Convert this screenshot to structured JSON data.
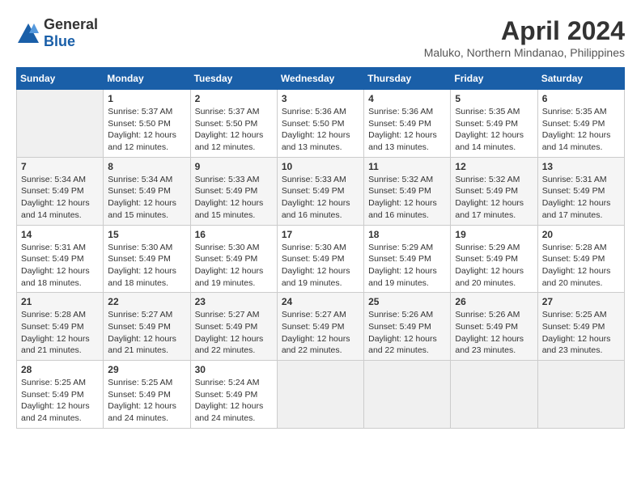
{
  "header": {
    "logo_general": "General",
    "logo_blue": "Blue",
    "month_year": "April 2024",
    "location": "Maluko, Northern Mindanao, Philippines"
  },
  "weekdays": [
    "Sunday",
    "Monday",
    "Tuesday",
    "Wednesday",
    "Thursday",
    "Friday",
    "Saturday"
  ],
  "weeks": [
    [
      {
        "day": "",
        "info": ""
      },
      {
        "day": "1",
        "info": "Sunrise: 5:37 AM\nSunset: 5:50 PM\nDaylight: 12 hours\nand 12 minutes."
      },
      {
        "day": "2",
        "info": "Sunrise: 5:37 AM\nSunset: 5:50 PM\nDaylight: 12 hours\nand 12 minutes."
      },
      {
        "day": "3",
        "info": "Sunrise: 5:36 AM\nSunset: 5:50 PM\nDaylight: 12 hours\nand 13 minutes."
      },
      {
        "day": "4",
        "info": "Sunrise: 5:36 AM\nSunset: 5:49 PM\nDaylight: 12 hours\nand 13 minutes."
      },
      {
        "day": "5",
        "info": "Sunrise: 5:35 AM\nSunset: 5:49 PM\nDaylight: 12 hours\nand 14 minutes."
      },
      {
        "day": "6",
        "info": "Sunrise: 5:35 AM\nSunset: 5:49 PM\nDaylight: 12 hours\nand 14 minutes."
      }
    ],
    [
      {
        "day": "7",
        "info": "Sunrise: 5:34 AM\nSunset: 5:49 PM\nDaylight: 12 hours\nand 14 minutes."
      },
      {
        "day": "8",
        "info": "Sunrise: 5:34 AM\nSunset: 5:49 PM\nDaylight: 12 hours\nand 15 minutes."
      },
      {
        "day": "9",
        "info": "Sunrise: 5:33 AM\nSunset: 5:49 PM\nDaylight: 12 hours\nand 15 minutes."
      },
      {
        "day": "10",
        "info": "Sunrise: 5:33 AM\nSunset: 5:49 PM\nDaylight: 12 hours\nand 16 minutes."
      },
      {
        "day": "11",
        "info": "Sunrise: 5:32 AM\nSunset: 5:49 PM\nDaylight: 12 hours\nand 16 minutes."
      },
      {
        "day": "12",
        "info": "Sunrise: 5:32 AM\nSunset: 5:49 PM\nDaylight: 12 hours\nand 17 minutes."
      },
      {
        "day": "13",
        "info": "Sunrise: 5:31 AM\nSunset: 5:49 PM\nDaylight: 12 hours\nand 17 minutes."
      }
    ],
    [
      {
        "day": "14",
        "info": "Sunrise: 5:31 AM\nSunset: 5:49 PM\nDaylight: 12 hours\nand 18 minutes."
      },
      {
        "day": "15",
        "info": "Sunrise: 5:30 AM\nSunset: 5:49 PM\nDaylight: 12 hours\nand 18 minutes."
      },
      {
        "day": "16",
        "info": "Sunrise: 5:30 AM\nSunset: 5:49 PM\nDaylight: 12 hours\nand 19 minutes."
      },
      {
        "day": "17",
        "info": "Sunrise: 5:30 AM\nSunset: 5:49 PM\nDaylight: 12 hours\nand 19 minutes."
      },
      {
        "day": "18",
        "info": "Sunrise: 5:29 AM\nSunset: 5:49 PM\nDaylight: 12 hours\nand 19 minutes."
      },
      {
        "day": "19",
        "info": "Sunrise: 5:29 AM\nSunset: 5:49 PM\nDaylight: 12 hours\nand 20 minutes."
      },
      {
        "day": "20",
        "info": "Sunrise: 5:28 AM\nSunset: 5:49 PM\nDaylight: 12 hours\nand 20 minutes."
      }
    ],
    [
      {
        "day": "21",
        "info": "Sunrise: 5:28 AM\nSunset: 5:49 PM\nDaylight: 12 hours\nand 21 minutes."
      },
      {
        "day": "22",
        "info": "Sunrise: 5:27 AM\nSunset: 5:49 PM\nDaylight: 12 hours\nand 21 minutes."
      },
      {
        "day": "23",
        "info": "Sunrise: 5:27 AM\nSunset: 5:49 PM\nDaylight: 12 hours\nand 22 minutes."
      },
      {
        "day": "24",
        "info": "Sunrise: 5:27 AM\nSunset: 5:49 PM\nDaylight: 12 hours\nand 22 minutes."
      },
      {
        "day": "25",
        "info": "Sunrise: 5:26 AM\nSunset: 5:49 PM\nDaylight: 12 hours\nand 22 minutes."
      },
      {
        "day": "26",
        "info": "Sunrise: 5:26 AM\nSunset: 5:49 PM\nDaylight: 12 hours\nand 23 minutes."
      },
      {
        "day": "27",
        "info": "Sunrise: 5:25 AM\nSunset: 5:49 PM\nDaylight: 12 hours\nand 23 minutes."
      }
    ],
    [
      {
        "day": "28",
        "info": "Sunrise: 5:25 AM\nSunset: 5:49 PM\nDaylight: 12 hours\nand 24 minutes."
      },
      {
        "day": "29",
        "info": "Sunrise: 5:25 AM\nSunset: 5:49 PM\nDaylight: 12 hours\nand 24 minutes."
      },
      {
        "day": "30",
        "info": "Sunrise: 5:24 AM\nSunset: 5:49 PM\nDaylight: 12 hours\nand 24 minutes."
      },
      {
        "day": "",
        "info": ""
      },
      {
        "day": "",
        "info": ""
      },
      {
        "day": "",
        "info": ""
      },
      {
        "day": "",
        "info": ""
      }
    ]
  ]
}
